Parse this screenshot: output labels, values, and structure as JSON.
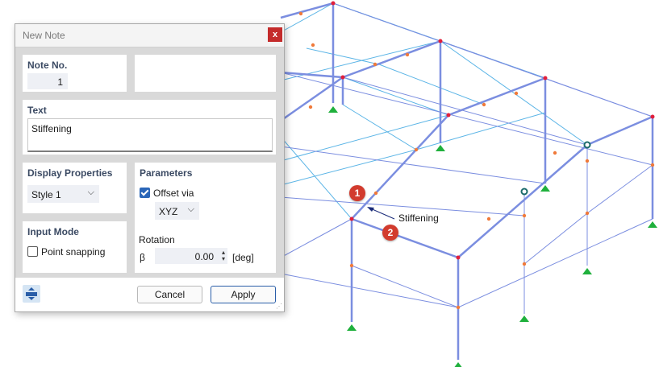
{
  "dialog": {
    "title": "New Note",
    "close_label": "x",
    "note_no": {
      "heading": "Note No.",
      "value": "1"
    },
    "text": {
      "heading": "Text",
      "value": "Stiffening"
    },
    "display_properties": {
      "heading": "Display Properties",
      "style_value": "Style 1"
    },
    "parameters": {
      "heading": "Parameters",
      "offset_via_label": "Offset via",
      "offset_via_checked": true,
      "coord_system_value": "XYZ",
      "rotation_heading": "Rotation",
      "beta_symbol": "β",
      "rotation_value": "0.00",
      "rotation_unit": "[deg]"
    },
    "input_mode": {
      "heading": "Input Mode",
      "point_snapping_label": "Point snapping",
      "point_snapping_checked": false
    },
    "buttons": {
      "cancel": "Cancel",
      "apply": "Apply"
    }
  },
  "viewport": {
    "note_label": "Stiffening",
    "badge_1": "1",
    "badge_2": "2",
    "colors": {
      "member": "#7b8ee0",
      "member_light": "#5ab4e6",
      "node": "#e11f3b",
      "division_point": "#f07a3a",
      "support": "#1fb03c"
    }
  }
}
